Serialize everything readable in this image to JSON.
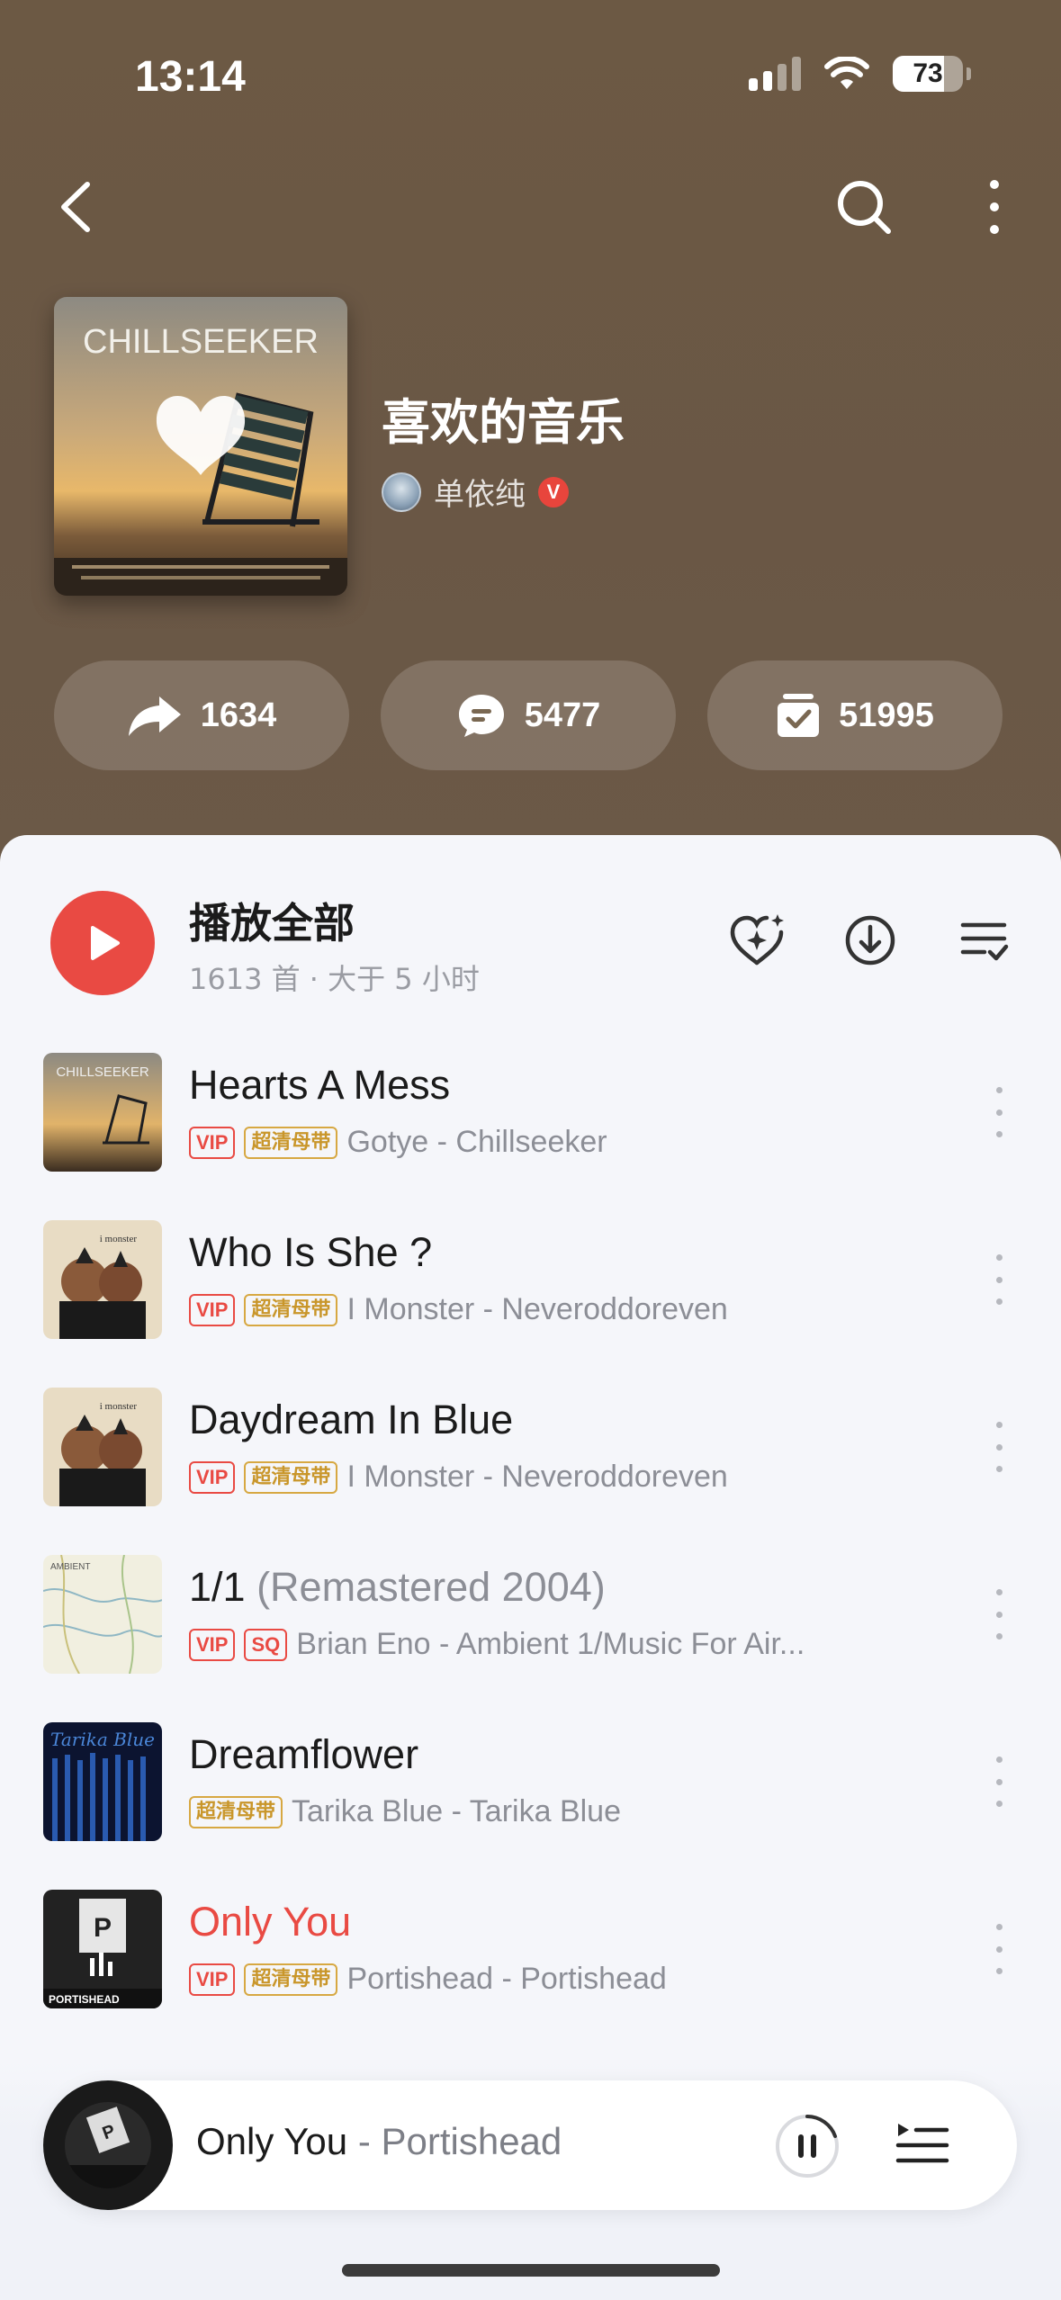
{
  "status_bar": {
    "time": "13:14",
    "battery": "73",
    "battery_level": 0.73
  },
  "nav": {
    "back_icon": "back-chevron-icon",
    "search_icon": "search-icon",
    "more_icon": "more-vertical-icon"
  },
  "playlist": {
    "title": "喜欢的音乐",
    "creator": "单依纯",
    "creator_badge": "V",
    "cover_text": "CHILLSEEKER"
  },
  "actions": [
    {
      "name": "share",
      "count": "1634"
    },
    {
      "name": "comment",
      "count": "5477"
    },
    {
      "name": "collect",
      "count": "51995"
    }
  ],
  "play_all": {
    "label": "播放全部",
    "sub": "1613 首 · 大于 5 小时"
  },
  "songs": [
    {
      "title": "Hearts A Mess",
      "title_extra": "",
      "tags": [
        "VIP",
        "超清母带"
      ],
      "artist": "Gotye - Chillseeker",
      "playing": false
    },
    {
      "title": "Who Is She ?",
      "title_extra": "",
      "tags": [
        "VIP",
        "超清母带"
      ],
      "artist": "I Monster - Neveroddoreven",
      "playing": false
    },
    {
      "title": "Daydream In Blue",
      "title_extra": "",
      "tags": [
        "VIP",
        "超清母带"
      ],
      "artist": "I Monster - Neveroddoreven",
      "playing": false
    },
    {
      "title": "1/1",
      "title_extra": " (Remastered 2004)",
      "tags": [
        "VIP",
        "SQ"
      ],
      "artist": "Brian Eno - Ambient 1/Music For Air...",
      "playing": false
    },
    {
      "title": "Dreamflower",
      "title_extra": "",
      "tags": [
        "超清母带"
      ],
      "artist": "Tarika Blue - Tarika Blue",
      "playing": false
    },
    {
      "title": "Only You",
      "title_extra": "",
      "tags": [
        "VIP",
        "超清母带"
      ],
      "artist": "Portishead - Portishead",
      "playing": true
    }
  ],
  "mini_player": {
    "title": "Only You",
    "artist": " - Portishead"
  },
  "colors": {
    "accent": "#e94a43",
    "header_bg": "#6a5846",
    "sheet_bg": "#f5f6fa",
    "gold_tag": "#c9962a"
  }
}
